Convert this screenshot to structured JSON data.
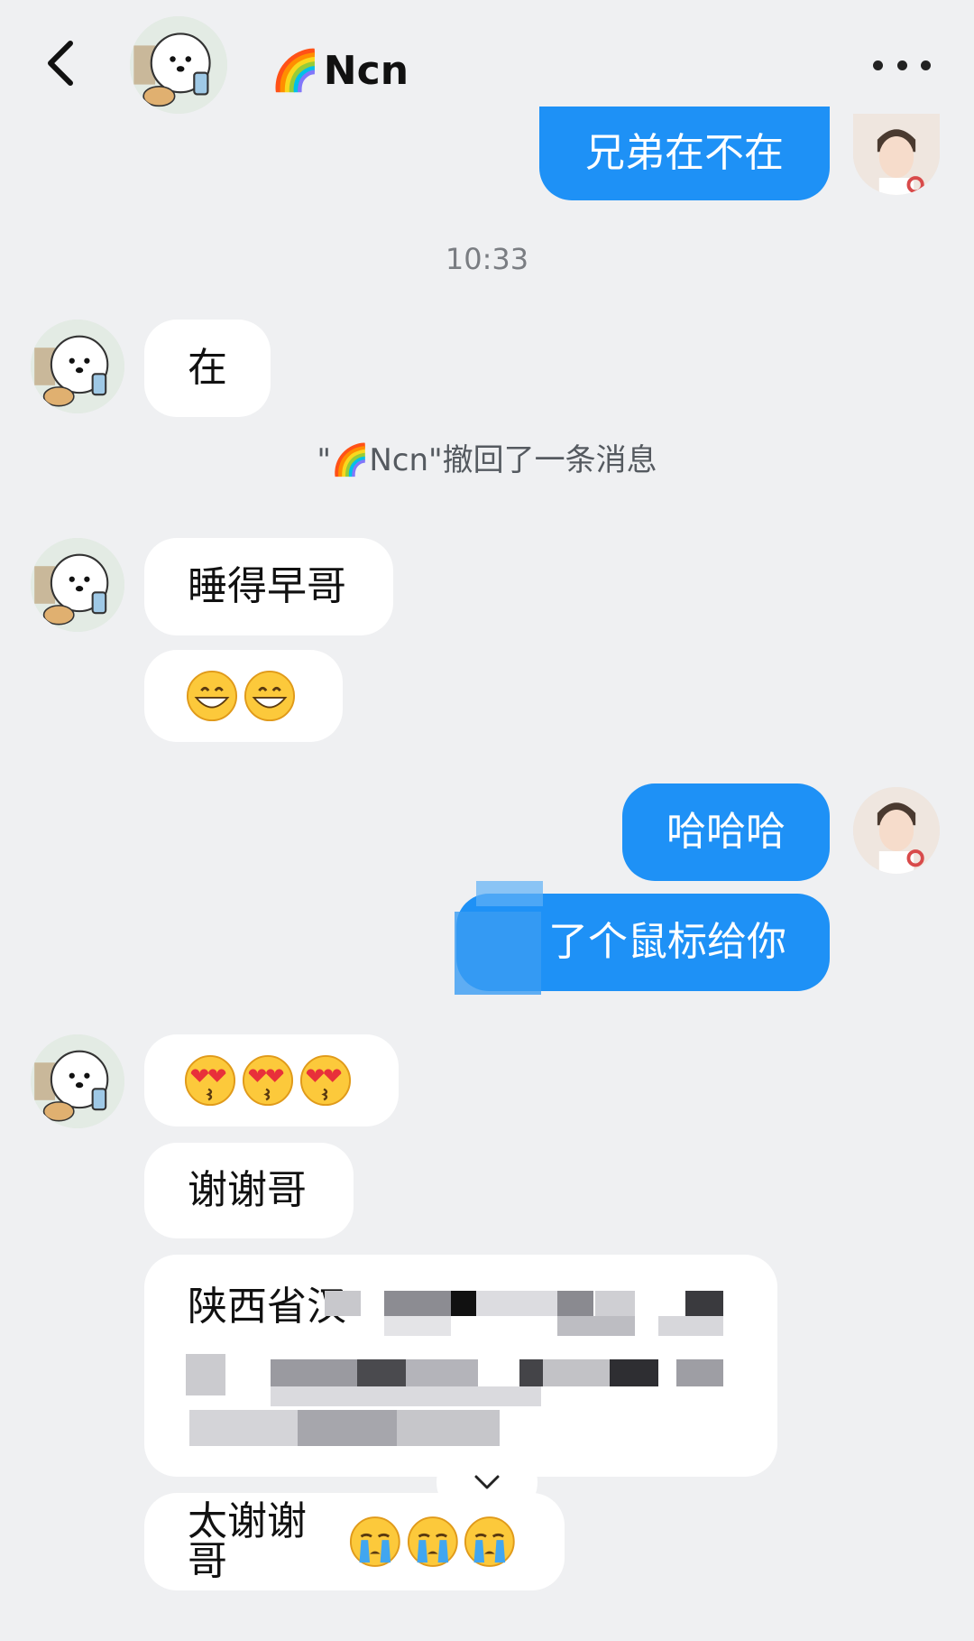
{
  "header": {
    "back_icon": "chevron-left-icon",
    "contact_name": "Ncn",
    "name_emoji": "🌈",
    "more_icon": "more-dots-icon"
  },
  "messages": {
    "m1_out": "兄弟在不在",
    "time": "10:33",
    "m2_in": "在",
    "recall_notice": "\"🌈Ncn\"撤回了一条消息",
    "m3_in": "睡得早哥",
    "m4_in_emoji": [
      "grin-emoji",
      "grin-emoji"
    ],
    "m5_out": "哈哈哈",
    "m6_out": "了个鼠标给你",
    "m7_in_emoji": [
      "kiss-heart-eyes-emoji",
      "kiss-heart-eyes-emoji",
      "kiss-heart-eyes-emoji"
    ],
    "m8_in": "谢谢哥",
    "m9_in_address": "陕西省汉",
    "m10_in": "太谢谢哥",
    "m10_emoji": [
      "crying-emoji",
      "crying-emoji",
      "crying-emoji"
    ]
  },
  "colors": {
    "background": "#eff0f2",
    "outgoing_bubble": "#1e91f6",
    "incoming_bubble": "#ffffff"
  }
}
